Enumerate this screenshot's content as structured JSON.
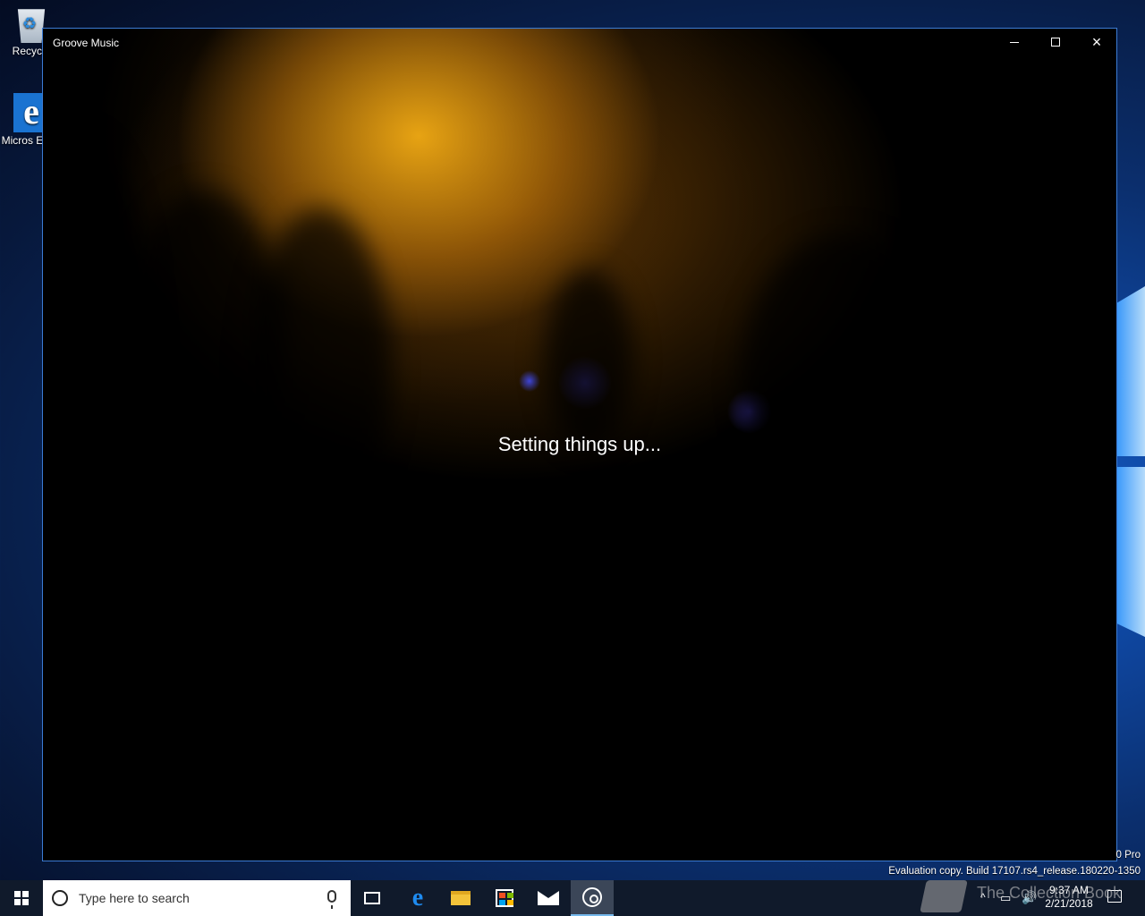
{
  "desktop": {
    "icons": [
      {
        "label": "Recycle"
      },
      {
        "label": "Micros Edge"
      }
    ],
    "watermark": {
      "line1": "0 Pro",
      "line2": "Evaluation copy. Build 17107.rs4_release.180220-1350"
    }
  },
  "window": {
    "title": "Groove Music",
    "status_text": "Setting things up...",
    "controls": {
      "minimize": "minimize",
      "maximize": "maximize",
      "close": "×"
    }
  },
  "taskbar": {
    "search_placeholder": "Type here to search",
    "apps": [
      {
        "name": "task-view"
      },
      {
        "name": "edge"
      },
      {
        "name": "file-explorer"
      },
      {
        "name": "store"
      },
      {
        "name": "mail"
      },
      {
        "name": "groove-music",
        "active": true
      }
    ],
    "clock": {
      "time": "9:37 AM",
      "date": "2/21/2018"
    },
    "tray_chevron": "^",
    "overlay_text": "The Collection Book"
  },
  "colors": {
    "accent": "#76b9ed",
    "taskbar_bg": "#101a2b",
    "window_border": "#3b7bd4"
  }
}
